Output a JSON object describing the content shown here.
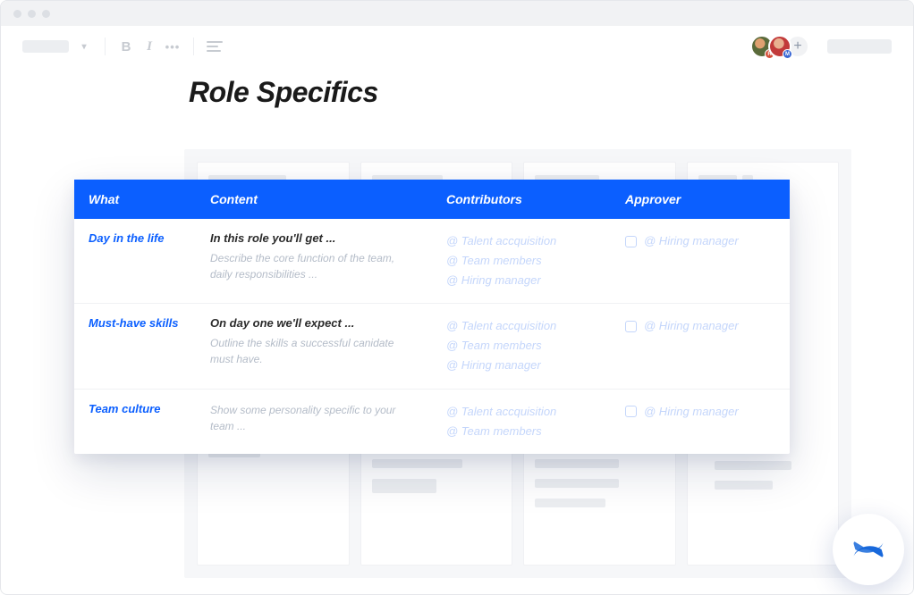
{
  "toolbar": {
    "bold_label": "B",
    "italic_label": "I",
    "more_label": "•••"
  },
  "avatars": {
    "user1_initial": "R",
    "user2_initial": "M",
    "add_label": "+"
  },
  "page": {
    "title": "Role Specifics"
  },
  "table": {
    "headers": {
      "what": "What",
      "content": "Content",
      "contributors": "Contributors",
      "approver": "Approver"
    },
    "rows": [
      {
        "what": "Day in the life",
        "content_title": "In this role you'll get ...",
        "content_desc": "Describe the core function of the team, daily responsibilities ...",
        "contributors": [
          "@ Talent accquisition",
          "@ Team members",
          "@ Hiring manager"
        ],
        "approver": "@ Hiring manager"
      },
      {
        "what": "Must-have skills",
        "content_title": "On day one we'll expect ...",
        "content_desc": "Outline the skills a successful canidate must have.",
        "contributors": [
          "@ Talent accquisition",
          "@ Team members",
          "@ Hiring manager"
        ],
        "approver": "@ Hiring manager"
      },
      {
        "what": "Team culture",
        "content_title": "",
        "content_desc": "Show some personality specific to your team ...",
        "contributors": [
          "@ Talent accquisition",
          "@ Team members"
        ],
        "approver": "@ Hiring manager"
      }
    ]
  },
  "colors": {
    "primary": "#0b5fff",
    "mention": "#c4d6fb"
  }
}
